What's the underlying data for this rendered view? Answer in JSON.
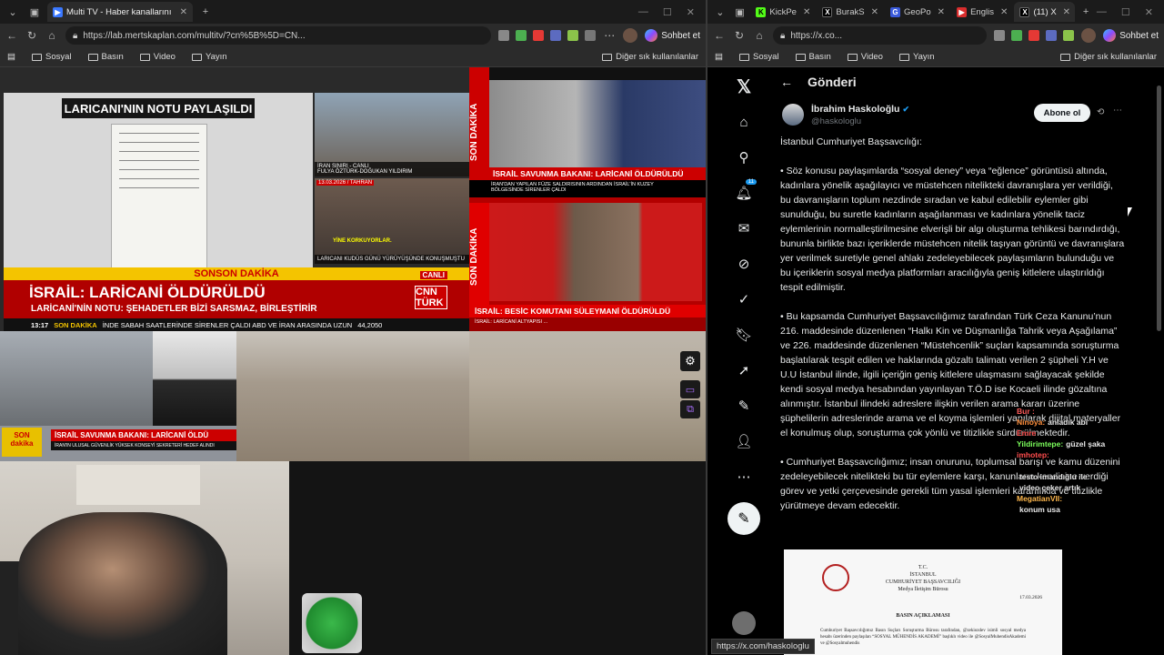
{
  "left_browser": {
    "tab": {
      "title": "Multi TV - Haber kanallarını aynı a"
    },
    "url": "https://lab.mertskaplan.com/multitv/?cn%5B%5D=CN...",
    "copilot_label": "Sohbet et",
    "bookmarks": [
      "Sosyal",
      "Basın",
      "Video",
      "Yayın"
    ],
    "other_bookmarks": "Diğer sık kullanılanlar"
  },
  "right_browser": {
    "tabs": [
      {
        "title": "KickPe",
        "color": "#53fc18",
        "letter": "K"
      },
      {
        "title": "BurakS",
        "color": "#000000",
        "letter": "X"
      },
      {
        "title": "GeoPo",
        "color": "#3b5bdb",
        "letter": "G"
      },
      {
        "title": "Englis",
        "color": "#d92d2d",
        "letter": "Y"
      },
      {
        "title": "(11) X",
        "color": "#000000",
        "letter": "X"
      }
    ],
    "url": "https://x.co...",
    "copilot_label": "Sohbet et",
    "bookmarks": [
      "Sosyal",
      "Basın",
      "Video",
      "Yayın"
    ],
    "other_bookmarks": "Diğer sık kullanılanlar",
    "status_url": "https://x.com/haskologlu"
  },
  "tv": {
    "paper_title": "LARICANI'NIN NOTU PAYLAŞILDI",
    "reporter_caption1": "İRAN SINIRI - CANLI",
    "reporter_caption2": "FULYA ÖZTÜRK-DOĞUKAN YILDIRIM",
    "crowd_date": "13.03.2026 / TAHRAN",
    "crowd_overlay": "YİNE KORKUYORLAR.",
    "crowd_caption": "LARICANI KUDÜS GÜNÜ YÜRÜYÜŞÜNDE KONUŞMUŞTU",
    "sonson": "SONSON DAKİKA",
    "canli": "CANLI",
    "cnn_headline": "İSRAİL: LARİCANİ ÖLDÜRÜLDÜ",
    "cnn_sub": "LARİCANİ'NİN NOTU: ŞEHADETLER BİZİ SARSMAZ, BİRLEŞTİRİR",
    "cnn_logo": "CNN TÜRK",
    "ticker_time": "13:17",
    "ticker_son": "SON DAKİKA",
    "ticker_text": "İNDE SABAH SAATLERİNDE SİRENLER ÇALDI   ABD VE İRAN ARASINDA UZUN",
    "ticker_num": "44,2050",
    "n2_vertical": "SON DAKİKA",
    "n2_headline": "İSRAİL SAVUNMA BAKANI: LARİCANİ ÖLDÜRÜLDÜ",
    "n2_sub": "İRAN'DAN YAPILAN FÜZE SALDIRISININ ARDINDAN İSRAİL'İN KUZEY BÖLGESİNDE SİRENLER ÇALDI",
    "n3_vertical": "SON DAKİKA",
    "n3_headline": "İSRAİL: BESİC KOMUTANI SÜLEYMANİ ÖLDÜRÜLDÜ",
    "n3_sub": "İSRAİL: LARİCANİ ALTYAPISI ...",
    "n4_son": "SON dakika",
    "n4_headline": "İSRAİL SAVUNMA BAKANI: LARİCANİ ÖLDÜ",
    "n4_sub": "İRAN'IN ULUSAL GÜVENLİK YÜKSEK KONSEYİ SEKRETERİ HEDEF ALINDI"
  },
  "x": {
    "header": "Gönderi",
    "notifications_badge": "11",
    "author_name": "İbrahim Haskoloğlu",
    "author_handle": "@haskologlu",
    "follow_label": "Abone ol",
    "paragraphs": [
      "İstanbul Cumhuriyet Başsavcılığı:",
      "• Söz konusu paylaşımlarda “sosyal deney” veya “eğlence” görüntüsü altında, kadınlara yönelik aşağılayıcı ve müstehcen nitelikteki davranışlara yer verildiği, bu davranışların toplum nezdinde sıradan ve kabul edilebilir eylemler gibi sunulduğu, bu suretle kadınların aşağılanması ve kadınlara yönelik taciz eylemlerinin normalleştirilmesine elverişli bir algı oluşturma tehlikesi barındırdığı, bununla birlikte bazı içeriklerde müstehcen nitelik taşıyan görüntü ve davranışlara yer verilmek suretiyle genel ahlakı zedeleyebilecek paylaşımların bulunduğu ve bu içeriklerin sosyal medya platformları aracılığıyla geniş kitlelere ulaştırıldığı tespit edilmiştir.",
      "• Bu kapsamda Cumhuriyet Başsavcılığımız tarafından Türk Ceza Kanunu’nun 216. maddesinde düzenlenen “Halkı Kin ve Düşmanlığa Tahrik veya Aşağılama” ve 226. maddesinde düzenlenen “Müstehcenlik” suçları kapsamında soruşturma başlatılarak tespit edilen ve haklarında gözaltı talimatı verilen 2 şüpheli Y.H ve U.U İstanbul ilinde, ilgili içeriğin geniş kitlelere ulaşmasını sağlayacak şekilde kendi sosyal medya hesabından yayınlayan T.Ö.D ise Kocaeli ilinde gözaltına alınmıştır. İstanbul ilindeki adreslere ilişkin verilen arama kararı üzerine şüphelilerin adreslerinde arama ve el koyma işlemleri yapılarak dijital materyaller el konulmuş olup, soruşturma çok yönlü ve titizlikle sürdürülmektedir.",
      "• Cumhuriyet Başsavcılığımız; insan onurunu, toplumsal barışı ve kamu düzenini zedeleyebilecek nitelikteki bu tür eylemlere karşı, kanunların kendisine verdiği görev ve yetki çerçevesinde gerekli tüm yasal işlemleri kararlılıkla ve titizlikle yürütmeye devam edecektir."
    ],
    "doc": {
      "line1": "T.C.",
      "line2": "İSTANBUL",
      "line3": "CUMHURİYET BAŞSAVCILIĞI",
      "line4": "Medya İletişim Bürosu",
      "date": "17.03.2026",
      "title": "BASIN AÇIKLAMASI",
      "body": "Cumhuriyet Başsavcılığımız Basın Suçları Soruşturma Bürosu tarafından, @zekiozdev isimli sosyal medya hesabı üzerinden paylaşılan “SOSYAL MÜHENDİS AKADEMİ” başlıklı video ile @SosyalMuhendisAkademi ve @Sosyalmuhendis"
    }
  },
  "chat": [
    {
      "user": "Bur :",
      "msg": "",
      "color": "#ff5c5c"
    },
    {
      "user": "Ninoya:",
      "msg": "anladık abi",
      "color": "#ff8f3d"
    },
    {
      "user": "Emre",
      "msg": "",
      "color": "#ff4d4d"
    },
    {
      "user": "Yildirimtepe:",
      "msg": "güzel şaka",
      "color": "#7cff5c"
    },
    {
      "user": "imhotep:",
      "msg": "",
      "color": "#ff4d4d"
    },
    {
      "user": "",
      "msg": "",
      "color": "#999999"
    },
    {
      "user": "",
      "msg": "testo imandığlu ile",
      "color": "#ff8f3d"
    },
    {
      "user": "",
      "msg": "video çeker artık",
      "color": "#ffffff"
    },
    {
      "user": "MegatianVII:",
      "msg": "",
      "color": "#ffb84d"
    },
    {
      "user": "",
      "msg": "konum usa",
      "color": "#ff6b6b"
    },
    {
      "user": "",
      "msg": "",
      "color": "#ff6bd6"
    }
  ]
}
